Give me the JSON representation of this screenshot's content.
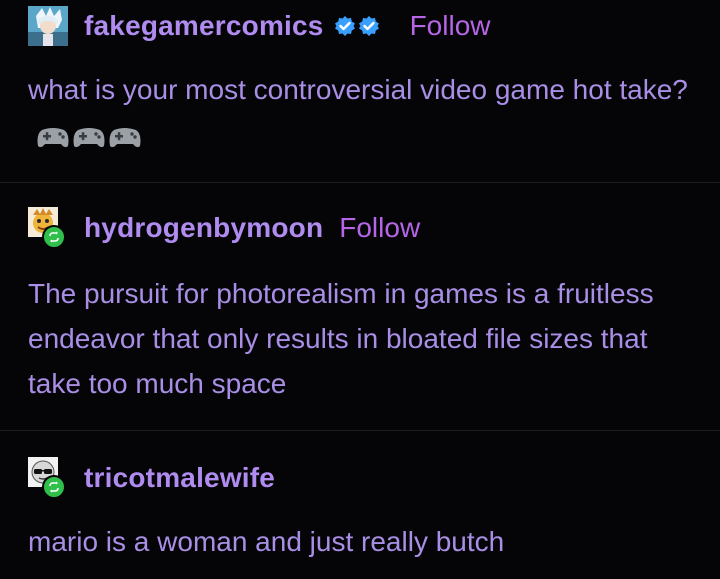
{
  "posts": [
    {
      "username": "fakegamercomics",
      "follow_label": "Follow",
      "verified": true,
      "avatar_icon": "anime-avatar-icon",
      "text": "what is your most controversial video game hot take?",
      "emoji": "gamepad-emoji x3"
    },
    {
      "username": "hydrogenbymoon",
      "follow_label": "Follow",
      "reblog": true,
      "avatar_icon": "cartoon-avatar-icon",
      "text": "The pursuit for photorealism in games is a fruitless endeavor that only results in bloated file sizes that take too much space"
    },
    {
      "username": "tricotmalewife",
      "reblog": true,
      "avatar_icon": "sunglasses-avatar-icon",
      "text": "mario is a woman and just really butch"
    }
  ],
  "colors": {
    "background": "#050507",
    "username": "#b18cf0",
    "follow": "#b565e6",
    "text": "#a98ee6",
    "reblog_badge": "#2fbf4a",
    "verified": "#3aa0ff"
  }
}
